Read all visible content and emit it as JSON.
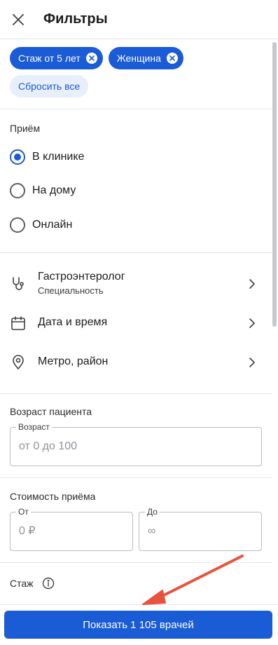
{
  "header": {
    "title": "Фильтры"
  },
  "chips": [
    {
      "label": "Стаж от 5 лет"
    },
    {
      "label": "Женщина"
    }
  ],
  "reset_label": "Сбросить все",
  "reception": {
    "label": "Приём",
    "options": [
      {
        "label": "В клинике",
        "checked": true
      },
      {
        "label": "На дому",
        "checked": false
      },
      {
        "label": "Онлайн",
        "checked": false
      }
    ]
  },
  "nav": [
    {
      "title": "Гастроэнтеролог",
      "subtitle": "Специальность",
      "icon": "stethoscope-icon"
    },
    {
      "title": "Дата и время",
      "icon": "calendar-icon"
    },
    {
      "title": "Метро, район",
      "icon": "location-pin-icon"
    }
  ],
  "patient_age": {
    "label": "Возраст пациента",
    "legend": "Возраст",
    "placeholder": "от 0 до 100"
  },
  "price": {
    "label": "Стоимость приёма",
    "from_legend": "От",
    "from_placeholder": "0 ₽",
    "to_legend": "До",
    "to_placeholder": "∞"
  },
  "experience": {
    "label": "Стаж",
    "icon": "info-icon"
  },
  "footer": {
    "show_button": "Показать 1 105 врачей"
  },
  "colors": {
    "accent": "#1a5bd6",
    "annotation_arrow": "#e8533f"
  }
}
